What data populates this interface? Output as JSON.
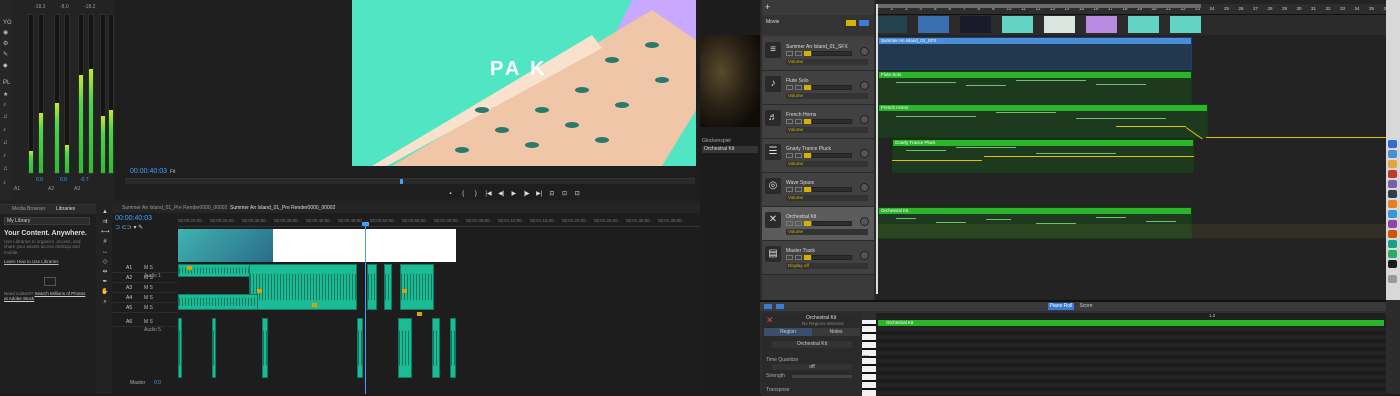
{
  "premiere": {
    "meters": {
      "top_db": [
        "-18.3",
        "-8.0",
        "-18.2"
      ],
      "bottom_db": [
        "0.0",
        "0.0",
        "-0.7"
      ],
      "channel_labels": [
        "A1",
        "A2",
        "A3"
      ],
      "side_labels": [
        "YG",
        "PL"
      ],
      "levels": [
        0.14,
        0.38,
        0.44,
        0.18,
        0.62,
        0.66,
        0.36,
        0.4
      ]
    },
    "program": {
      "frame_text": "PA  K",
      "timecode": "00:00:40:03",
      "fit": "Fit"
    },
    "transport": [
      "▪",
      "{",
      "}",
      "|◀",
      "◀|",
      "▶",
      "|▶",
      "▶|",
      "⊡",
      "⊡",
      "⊡"
    ],
    "library": {
      "tabs": [
        "Media Browser",
        "Libraries"
      ],
      "select": "My Library",
      "headline": "Your Content. Anywhere.",
      "body": "Use Libraries to organize, access, and share your assets across desktop and mobile.",
      "link": "Learn How to Use Libraries",
      "need": "Need content?",
      "need_link": "Search Millions of Photos at Adobe Stock"
    },
    "timeline": {
      "tabs": [
        "Summer An Island_01_Pre Render0000_00002",
        "Summer An Island_01_Pre Render0000_00002"
      ],
      "timecode": "00:00:40:03",
      "ruler": [
        "00:00:20:00",
        "00:00:25:00",
        "00:00:30:00",
        "00:00:35:00",
        "00:00:40:00",
        "00:00:45:00",
        "00:00:50:00",
        "00:00:55:00",
        "00:01:00:00",
        "00:01:05:00",
        "00:01:10:00",
        "00:01:15:00",
        "00:01:20:00",
        "00:01:25:00",
        "00:01:30:00",
        "00:01:35:00"
      ],
      "tracks": [
        {
          "id": "A1",
          "name": "Audio 1"
        },
        {
          "id": "A2",
          "name": ""
        },
        {
          "id": "A3",
          "name": ""
        },
        {
          "id": "A4",
          "name": ""
        },
        {
          "id": "A5",
          "name": ""
        },
        {
          "id": "A6",
          "name": "Audio 5"
        }
      ],
      "master_label": "Master",
      "master_value": "0.0"
    }
  },
  "logic": {
    "inspector": {
      "instrument": "Glockenspiel",
      "selected": "Orchestral Kit"
    },
    "movie_label": "Movie",
    "tracks": [
      {
        "name": "Summer An Island_01_SFX",
        "sub": "Volume"
      },
      {
        "name": "Flute Solo",
        "sub": "Volume"
      },
      {
        "name": "French Horns",
        "sub": "Volume"
      },
      {
        "name": "Gnarly Trance Pluck",
        "sub": "Volume"
      },
      {
        "name": "Wave Space",
        "sub": "Volume"
      },
      {
        "name": "Orchestral Kit",
        "sub": "Volume"
      },
      {
        "name": "Master Track",
        "sub": "Display off"
      }
    ],
    "ruler": [
      "1",
      "2",
      "3",
      "4",
      "5",
      "6",
      "7",
      "8",
      "9",
      "10",
      "11",
      "12",
      "13",
      "14",
      "15",
      "16",
      "17",
      "18",
      "19",
      "20",
      "21",
      "22",
      "23",
      "24",
      "25",
      "26",
      "27",
      "28",
      "29",
      "30",
      "31",
      "32",
      "33",
      "34",
      "35",
      "36"
    ],
    "regions": [
      {
        "label": "Summer An Island_01_SFX"
      },
      {
        "label": "Flute Solo"
      },
      {
        "label": "French Horns"
      },
      {
        "label": "Gnarly Trance Pluck"
      },
      {
        "label": "Orchestral Kit"
      }
    ],
    "piano_roll": {
      "tabs": [
        "Piano Roll",
        "Score"
      ],
      "title": "Orchestral Kit",
      "subtitle": "No Regions selected",
      "region_tab": "Region",
      "notes_tab": "Notes",
      "region_name": "Orchestral Kit",
      "time_quantize": "Time Quantize",
      "quantize_value": "off",
      "strength": "Strength",
      "transpose": "Transpose",
      "region_bar": "Orchestral Kit",
      "ruler_mark": "1.2",
      "key_label": "C4"
    }
  }
}
